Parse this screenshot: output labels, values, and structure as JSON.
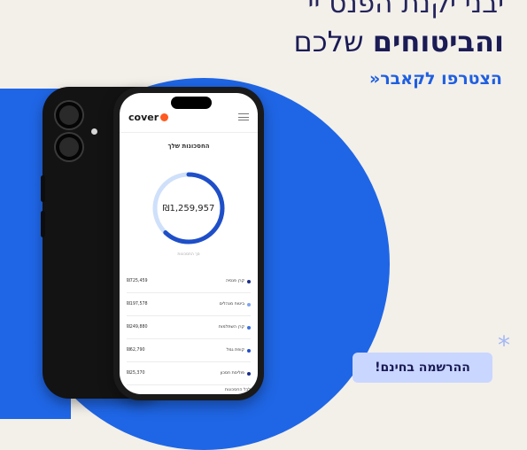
{
  "ad": {
    "headline_top": "יבני יקנת הפנס יי",
    "headline_bold": "והביטוחים",
    "headline_light": "שלכם",
    "join_link": "הצטרפו לקאבר«",
    "signup_button": "ההרשמה בחינם!",
    "sparkle_glyph": "*"
  },
  "phone": {
    "logo": "cover",
    "savings_title": "החסכונות שלך",
    "total_amount": "₪1,259,957",
    "donut_caption": "סך החסכונות",
    "donut_fraction": 0.62,
    "rows": [
      {
        "name": "קרן פנסיה",
        "amount": "₪725,459",
        "color": "#1b2d8a"
      },
      {
        "name": "ביטוח מנהלים",
        "amount": "₪197,578",
        "color": "#7fa5ee"
      },
      {
        "name": "קרן השתלמות",
        "amount": "₪249,880",
        "color": "#3f6fe0"
      },
      {
        "name": "קופת גמל",
        "amount": "₪62,790",
        "color": "#1f4fc8"
      },
      {
        "name": "פוליסת חסכון",
        "amount": "₪25,370",
        "color": "#1b2d8a"
      }
    ],
    "bottom_text": "לכל החסכונות"
  },
  "colors": {
    "background": "#f3f0ea",
    "circle_blue": "#1f66e6",
    "navy_text": "#1b1b55",
    "link_blue": "#1f5fe0",
    "button_bg": "#c9d6ff",
    "logo_dot": "#ff5a1f"
  }
}
